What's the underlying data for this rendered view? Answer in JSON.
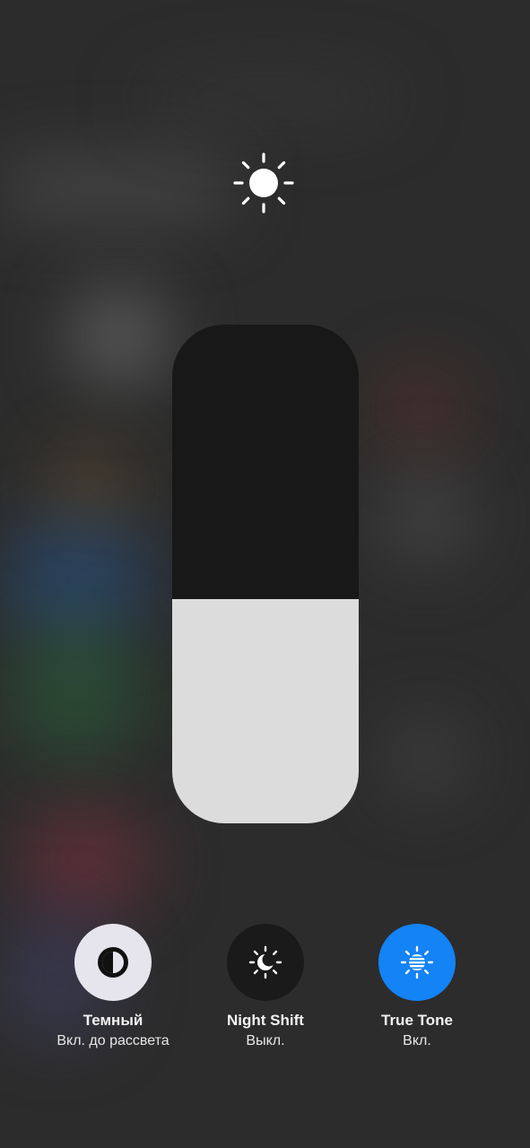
{
  "brightness": {
    "level": 0.45,
    "icon": "sun-icon"
  },
  "controls": [
    {
      "title": "Темный",
      "subtitle": "Вкл. до рассвета",
      "icon": "dark-mode-icon",
      "state": "on",
      "color": "#e6e4ec"
    },
    {
      "title": "Night Shift",
      "subtitle": "Выкл.",
      "icon": "night-shift-icon",
      "state": "off",
      "color": "#1a1a1a"
    },
    {
      "title": "True Tone",
      "subtitle": "Вкл.",
      "icon": "true-tone-icon",
      "state": "on",
      "color": "#1383f6"
    }
  ]
}
